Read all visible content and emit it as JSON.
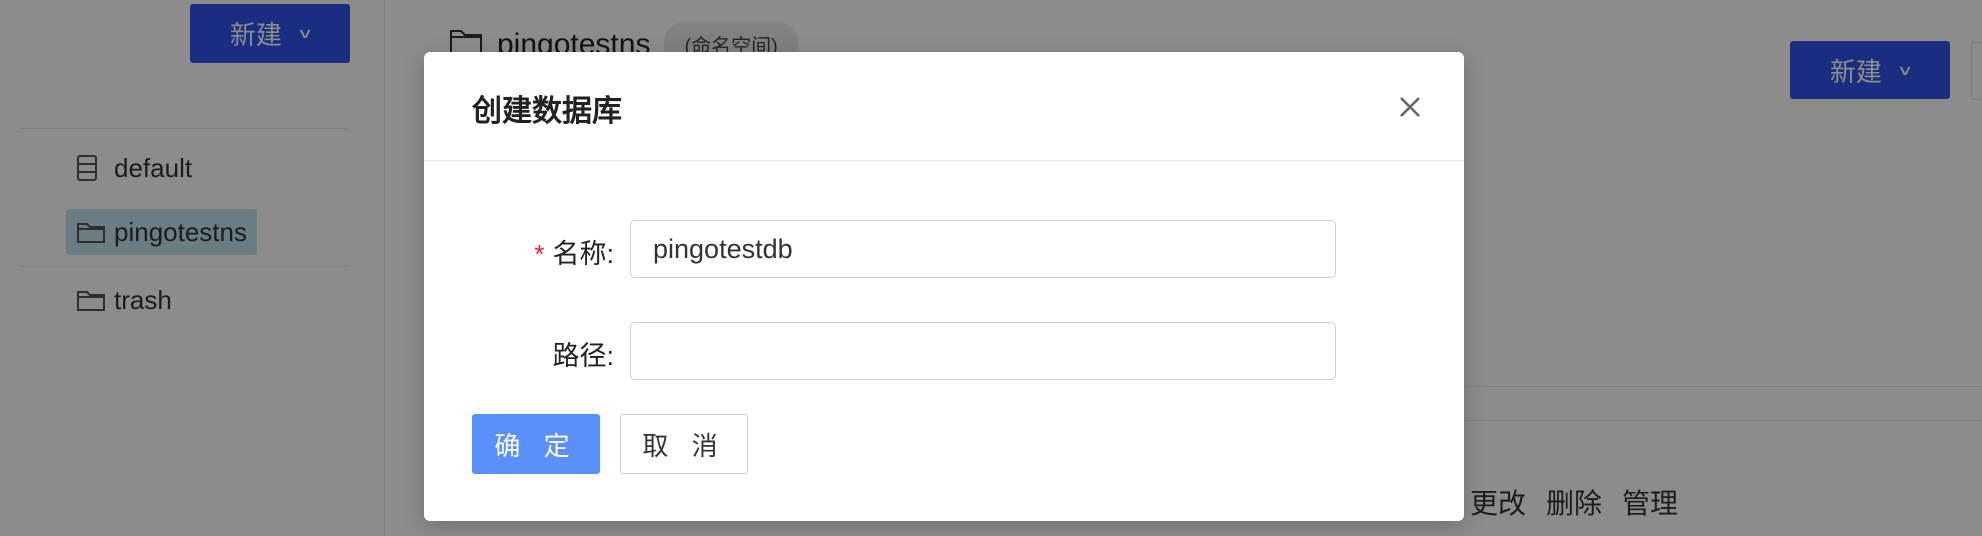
{
  "sidebar": {
    "new_button": "新建",
    "items": [
      {
        "label": "default",
        "icon": "database-icon"
      },
      {
        "label": "pingotestns",
        "icon": "folder-icon"
      },
      {
        "label": "trash",
        "icon": "folder-icon"
      }
    ]
  },
  "main": {
    "crumb": {
      "name": "pingotestns",
      "tag": "(命名空间)"
    },
    "new_button": "新建",
    "actions": [
      "更改",
      "删除",
      "管理"
    ]
  },
  "modal": {
    "title": "创建数据库",
    "fields": {
      "name": {
        "required_mark": "*",
        "label": "名称:",
        "value": "pingotestdb"
      },
      "path": {
        "label": "路径:",
        "value": ""
      }
    },
    "ok_button": "确 定",
    "cancel_button": "取 消"
  },
  "colors": {
    "primary": "#2f54eb",
    "ok_button": "#5b8ff9",
    "required": "#e8202f",
    "sidebar_active": "#c2e4ee"
  }
}
